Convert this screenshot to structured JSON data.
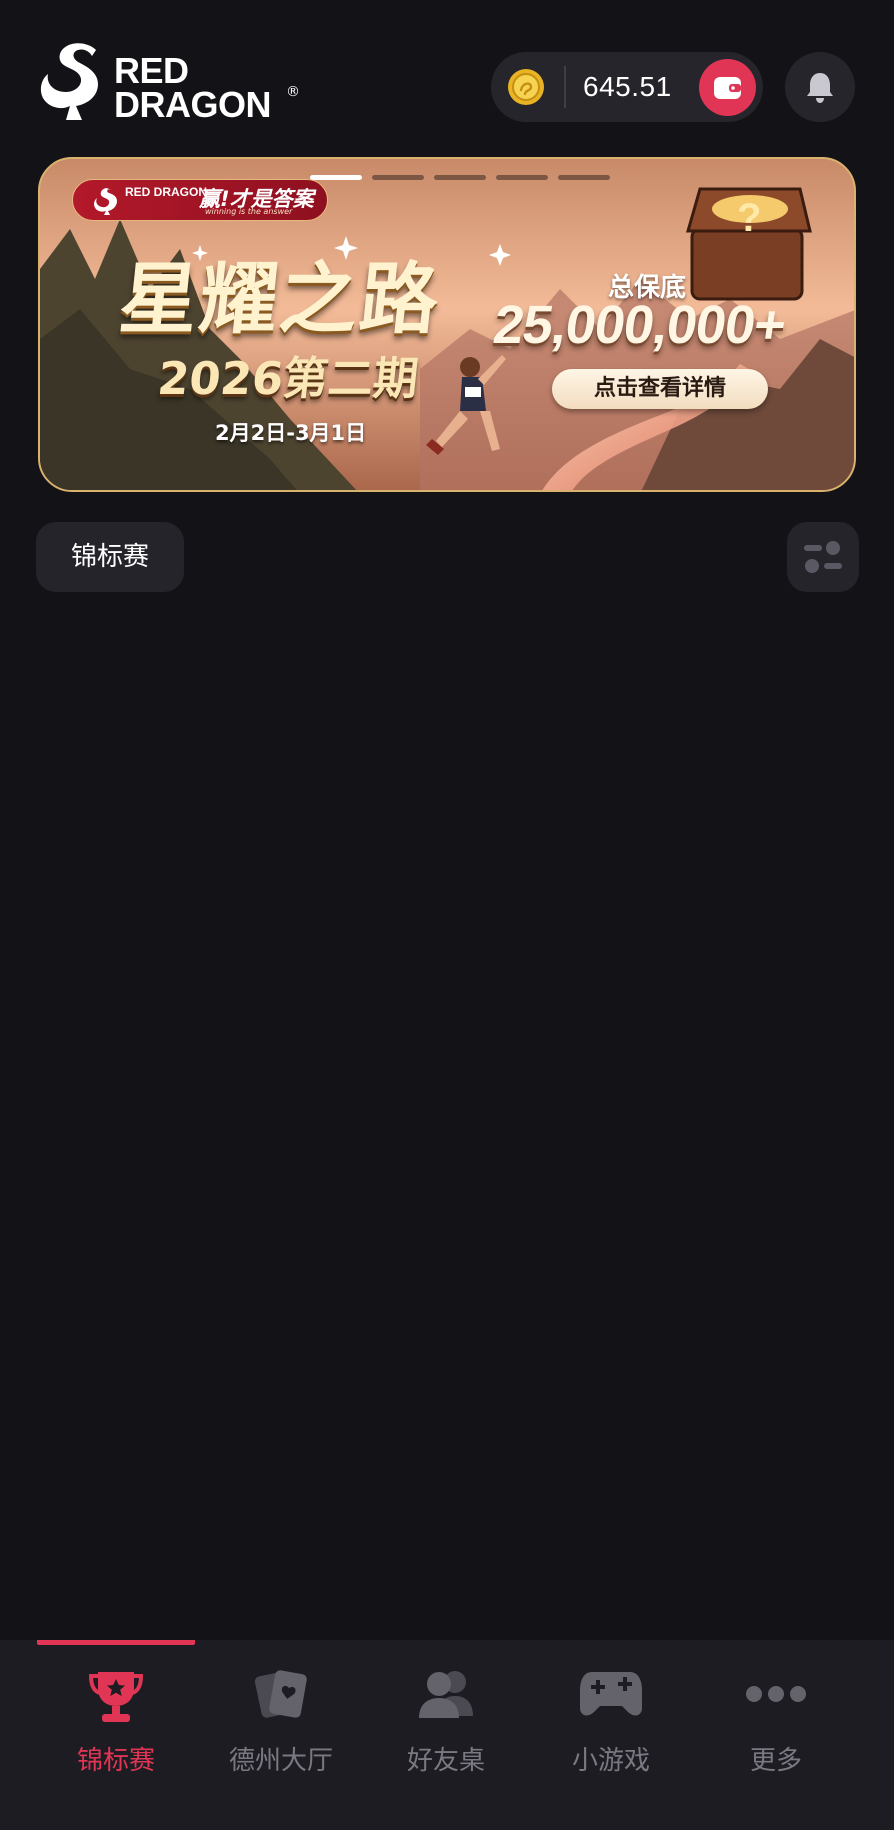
{
  "header": {
    "logo_text_line1": "RED",
    "logo_text_line2": "DRAGON",
    "logo_reg": "®",
    "balance": "645.51",
    "icons": [
      "dragon-logo-icon",
      "coin-icon",
      "wallet-icon",
      "bell-icon"
    ]
  },
  "banner": {
    "brand_tag": "RED DRAGON",
    "slogan": "赢!才是答案",
    "slogan_sub": "winning is the answer",
    "title": "星耀之路",
    "subtitle": "2026第二期",
    "date_range": "2月2日-3月1日",
    "guarantee_label": "总保底",
    "guarantee_value": "25,000,000+",
    "cta": "点击查看详情",
    "page_count": 5,
    "active_page": 1
  },
  "tabs": {
    "active_label": "锦标赛"
  },
  "bottom_nav": {
    "items": [
      {
        "label": "锦标赛",
        "icon": "trophy-icon",
        "active": true
      },
      {
        "label": "德州大厅",
        "icon": "cards-icon",
        "active": false
      },
      {
        "label": "好友桌",
        "icon": "friends-icon",
        "active": false
      },
      {
        "label": "小游戏",
        "icon": "gamepad-icon",
        "active": false
      },
      {
        "label": "更多",
        "icon": "more-icon",
        "active": false
      }
    ]
  },
  "colors": {
    "background": "#131217",
    "surface": "#25242b",
    "accent": "#e03555",
    "inactive_text": "#7a7983"
  }
}
